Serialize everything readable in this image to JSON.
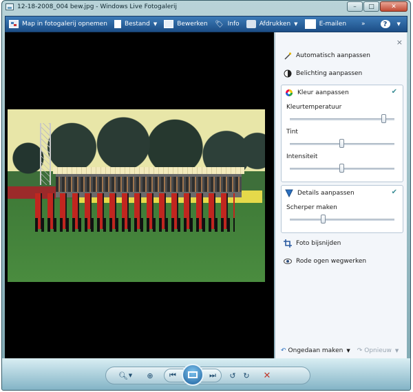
{
  "window": {
    "title": "12-18-2008_004 bew.jpg - Windows Live Fotogalerij"
  },
  "titlebar_buttons": {
    "minimize": "–",
    "maximize": "□",
    "close": "✕"
  },
  "toolbar": {
    "gallery": "Map in fotogalerij opnemen",
    "file": "Bestand",
    "edit": "Bewerken",
    "info": "Info",
    "print": "Afdrukken",
    "email": "E-mailen",
    "more": "»",
    "help": "?"
  },
  "panel": {
    "close": "×",
    "auto_adjust": "Automatisch aanpassen",
    "exposure": "Belichting aanpassen",
    "color": {
      "title": "Kleur aanpassen",
      "temperature": {
        "label": "Kleurtemperatuur",
        "level": 0.9
      },
      "tint": {
        "label": "Tint",
        "level": 0.5
      },
      "saturation": {
        "label": "Intensiteit",
        "level": 0.5
      }
    },
    "detail": {
      "title": "Details aanpassen",
      "sharpen": {
        "label": "Scherper maken",
        "level": 0.32
      }
    },
    "crop": "Foto bijsnijden",
    "redeye": "Rode ogen wegwerken",
    "undo": "Ongedaan maken",
    "redo": "Opnieuw"
  }
}
